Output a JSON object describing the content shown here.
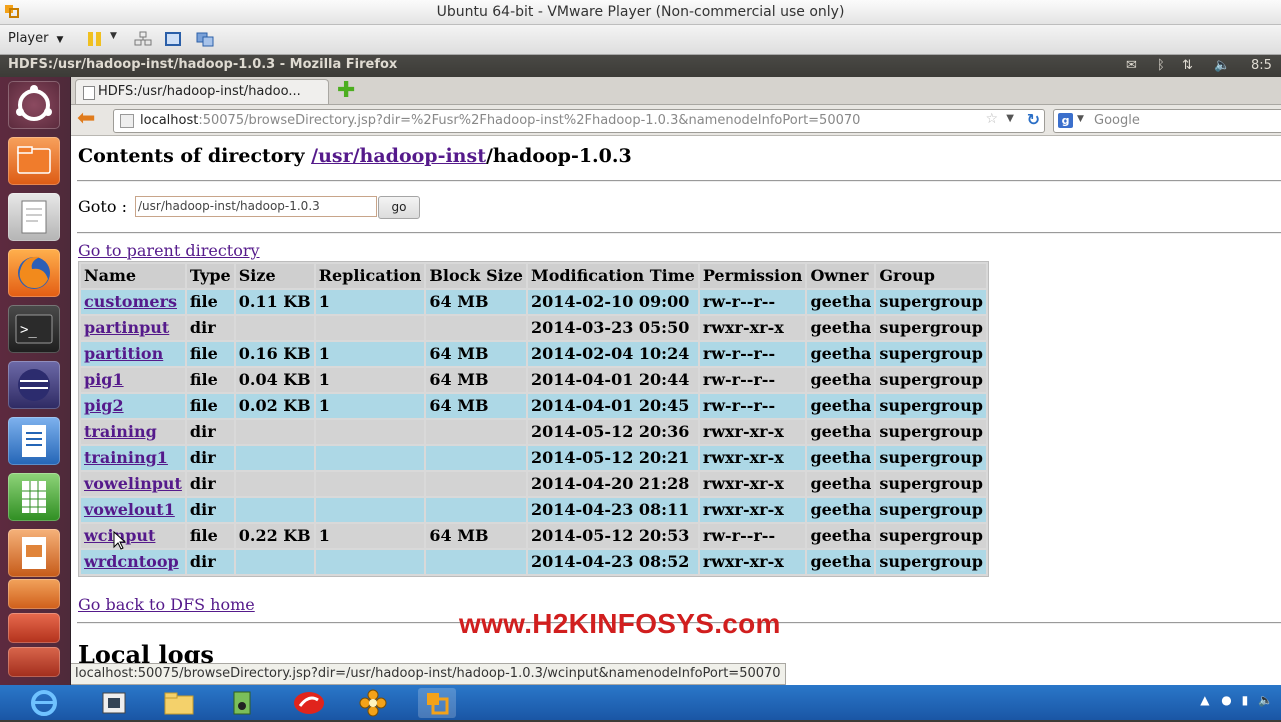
{
  "vmware": {
    "title": "Ubuntu 64-bit - VMware Player (Non-commercial use only)",
    "player_menu": "Player"
  },
  "ubuntu_panel": {
    "window_title": "HDFS:/usr/hadoop-inst/hadoop-1.0.3 - Mozilla Firefox",
    "clock": "8:5"
  },
  "browser": {
    "tab_label": "HDFS:/usr/hadoop-inst/hadoo...",
    "url_host": "localhost",
    "url_rest": ":50075/browseDirectory.jsp?dir=%2Fusr%2Fhadoop-inst%2Fhadoop-1.0.3&namenodeInfoPort=50070",
    "search_placeholder": "Google",
    "status_url": "localhost:50075/browseDirectory.jsp?dir=/usr/hadoop-inst/hadoop-1.0.3/wcinput&namenodeInfoPort=50070"
  },
  "page": {
    "heading_prefix": "Contents of directory ",
    "crumb_1": "/usr",
    "crumb_2": "/hadoop-inst",
    "crumb_3": "/hadoop-1.0.3",
    "goto_label": "Goto :",
    "goto_value": "/usr/hadoop-inst/hadoop-1.0.3",
    "go_button": "go",
    "parent_link": "Go to parent directory",
    "dfs_home_link": "Go back to DFS home",
    "local_logs": "Local logs",
    "watermark": "www.H2KINFOSYS.com"
  },
  "table": {
    "headers": [
      "Name",
      "Type",
      "Size",
      "Replication",
      "Block Size",
      "Modification Time",
      "Permission",
      "Owner",
      "Group"
    ],
    "rows": [
      [
        "customers",
        "file",
        "0.11 KB",
        "1",
        "64 MB",
        "2014-02-10 09:00",
        "rw-r--r--",
        "geetha",
        "supergroup"
      ],
      [
        "partinput",
        "dir",
        "",
        "",
        "",
        "2014-03-23 05:50",
        "rwxr-xr-x",
        "geetha",
        "supergroup"
      ],
      [
        "partition",
        "file",
        "0.16 KB",
        "1",
        "64 MB",
        "2014-02-04 10:24",
        "rw-r--r--",
        "geetha",
        "supergroup"
      ],
      [
        "pig1",
        "file",
        "0.04 KB",
        "1",
        "64 MB",
        "2014-04-01 20:44",
        "rw-r--r--",
        "geetha",
        "supergroup"
      ],
      [
        "pig2",
        "file",
        "0.02 KB",
        "1",
        "64 MB",
        "2014-04-01 20:45",
        "rw-r--r--",
        "geetha",
        "supergroup"
      ],
      [
        "training",
        "dir",
        "",
        "",
        "",
        "2014-05-12 20:36",
        "rwxr-xr-x",
        "geetha",
        "supergroup"
      ],
      [
        "training1",
        "dir",
        "",
        "",
        "",
        "2014-05-12 20:21",
        "rwxr-xr-x",
        "geetha",
        "supergroup"
      ],
      [
        "vowelinput",
        "dir",
        "",
        "",
        "",
        "2014-04-20 21:28",
        "rwxr-xr-x",
        "geetha",
        "supergroup"
      ],
      [
        "vowelout1",
        "dir",
        "",
        "",
        "",
        "2014-04-23 08:11",
        "rwxr-xr-x",
        "geetha",
        "supergroup"
      ],
      [
        "wcinput",
        "file",
        "0.22 KB",
        "1",
        "64 MB",
        "2014-05-12 20:53",
        "rw-r--r--",
        "geetha",
        "supergroup"
      ],
      [
        "wrdcntoop",
        "dir",
        "",
        "",
        "",
        "2014-04-23 08:52",
        "rwxr-xr-x",
        "geetha",
        "supergroup"
      ]
    ]
  },
  "launcher_icons": [
    "ubuntu-dash-icon",
    "files-icon",
    "text-editor-icon",
    "firefox-icon",
    "terminal-icon",
    "eclipse-icon",
    "writer-icon",
    "calc-icon",
    "impress-icon",
    "app-icon",
    "app-icon",
    "app-icon"
  ],
  "taskbar_icons": [
    "internet-explorer-icon",
    "explorer-icon",
    "folder-icon",
    "media-icon",
    "app-icon",
    "flower-app-icon",
    "vmware-icon"
  ],
  "colors": {
    "row_even": "#add8e6",
    "row_odd": "#d3d3d3",
    "link": "#551a8b",
    "watermark": "#d11e1e"
  }
}
